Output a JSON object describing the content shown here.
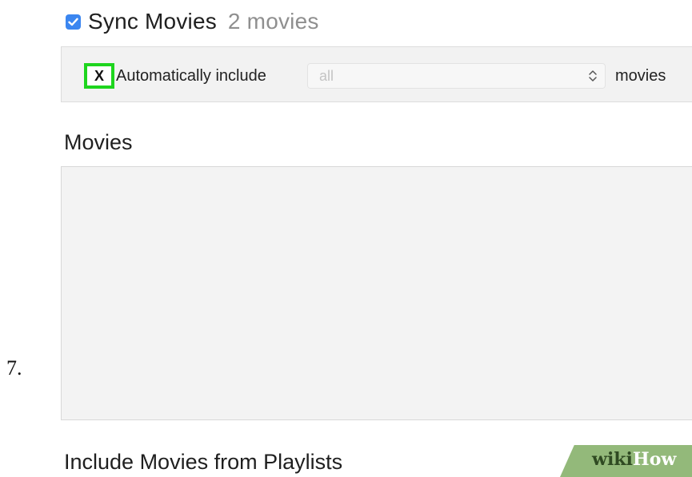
{
  "step": {
    "number": "7."
  },
  "sync": {
    "checked": true,
    "title": "Sync Movies",
    "count": "2 movies"
  },
  "auto_include": {
    "checkbox_mark": "X",
    "label": "Automatically include",
    "select_value": "all",
    "suffix": "movies"
  },
  "movies_section": {
    "heading": "Movies"
  },
  "playlists_section": {
    "heading": "Include Movies from Playlists"
  },
  "watermark": {
    "part_a": "wiki",
    "part_b": "How"
  },
  "colors": {
    "checkbox_blue": "#3b86f0",
    "highlight_green": "#1ed51e",
    "watermark_green": "#93b97a"
  }
}
